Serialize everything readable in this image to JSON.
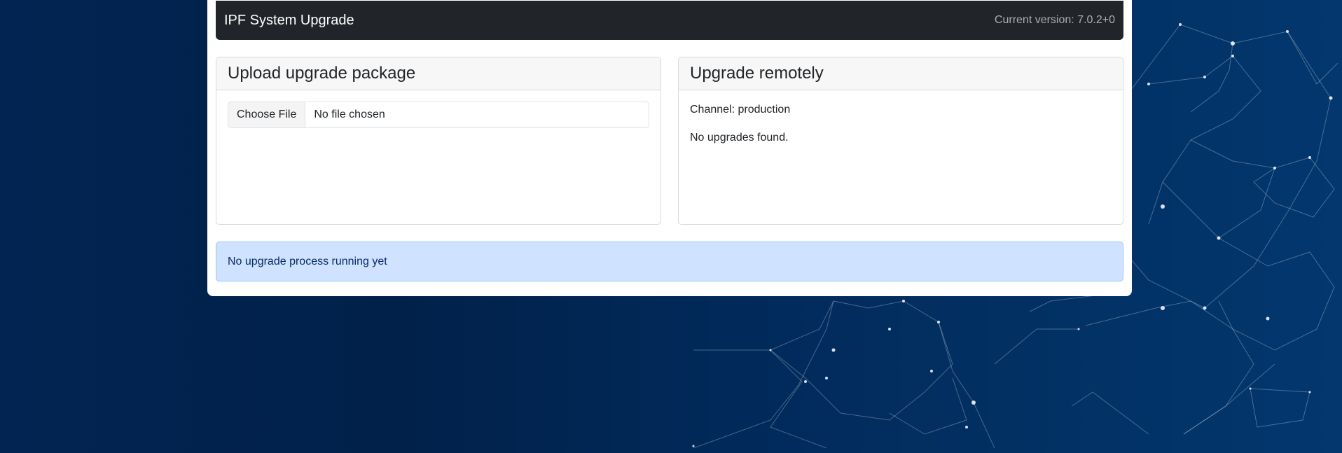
{
  "navbar": {
    "brand": "IPF System Upgrade",
    "version_text": "Current version: 7.0.2+0"
  },
  "upload_card": {
    "title": "Upload upgrade package",
    "choose_file_label": "Choose File",
    "file_status": "No file chosen"
  },
  "remote_card": {
    "title": "Upgrade remotely",
    "channel_text": "Channel: production",
    "status_text": "No upgrades found."
  },
  "alert": {
    "text": "No upgrade process running yet"
  },
  "colors": {
    "navbar_bg": "#212529",
    "alert_bg": "#cfe2ff",
    "alert_border": "#9ec5fe",
    "alert_text": "#052c65",
    "page_bg_dark": "#01214a",
    "page_bg_light": "#03376e"
  }
}
